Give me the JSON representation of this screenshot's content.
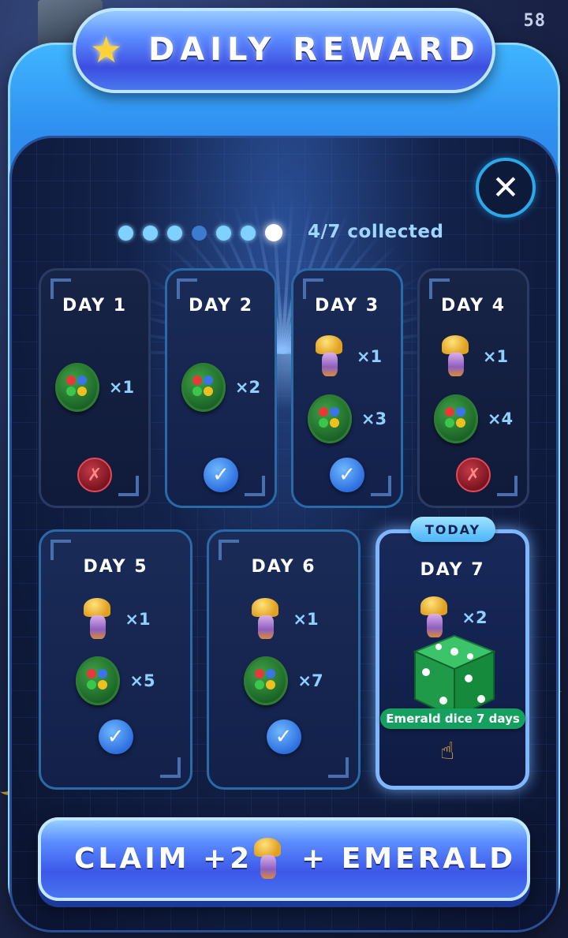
{
  "header": {
    "counter": "58"
  },
  "title": {
    "text": "DAILY REWARD"
  },
  "progress": {
    "text": "4/7 collected",
    "dots": [
      "filled",
      "filled",
      "filled",
      "dim",
      "filled",
      "filled",
      "current"
    ]
  },
  "days": [
    {
      "label": "DAY 1",
      "rewards": [
        {
          "icon": "coin-icon",
          "qty": "×1"
        }
      ],
      "status": "missed"
    },
    {
      "label": "DAY 2",
      "rewards": [
        {
          "icon": "coin-icon",
          "qty": "×2"
        }
      ],
      "status": "claimed"
    },
    {
      "label": "DAY 3",
      "rewards": [
        {
          "icon": "lamp-icon",
          "qty": "×1"
        },
        {
          "icon": "coin-icon",
          "qty": "×3"
        }
      ],
      "status": "claimed"
    },
    {
      "label": "DAY 4",
      "rewards": [
        {
          "icon": "lamp-icon",
          "qty": "×1"
        },
        {
          "icon": "coin-icon",
          "qty": "×4"
        }
      ],
      "status": "missed"
    },
    {
      "label": "DAY 5",
      "rewards": [
        {
          "icon": "lamp-icon",
          "qty": "×1"
        },
        {
          "icon": "coin-icon",
          "qty": "×5"
        }
      ],
      "status": "claimed"
    },
    {
      "label": "DAY 6",
      "rewards": [
        {
          "icon": "lamp-icon",
          "qty": "×1"
        },
        {
          "icon": "coin-icon",
          "qty": "×7"
        }
      ],
      "status": "claimed"
    },
    {
      "label": "DAY 7",
      "rewards": [
        {
          "icon": "lamp-icon",
          "qty": "×2"
        }
      ],
      "status": "today",
      "badge": "TODAY",
      "bonus": "Emerald dice 7 days"
    }
  ],
  "claim": {
    "label": "CLAIM +2",
    "suffix": "+ EMERALD"
  },
  "colors": {
    "accent": "#3c58e8",
    "claimed": "#2d6fe0",
    "missed": "#7a1420",
    "emerald": "#16a060"
  }
}
